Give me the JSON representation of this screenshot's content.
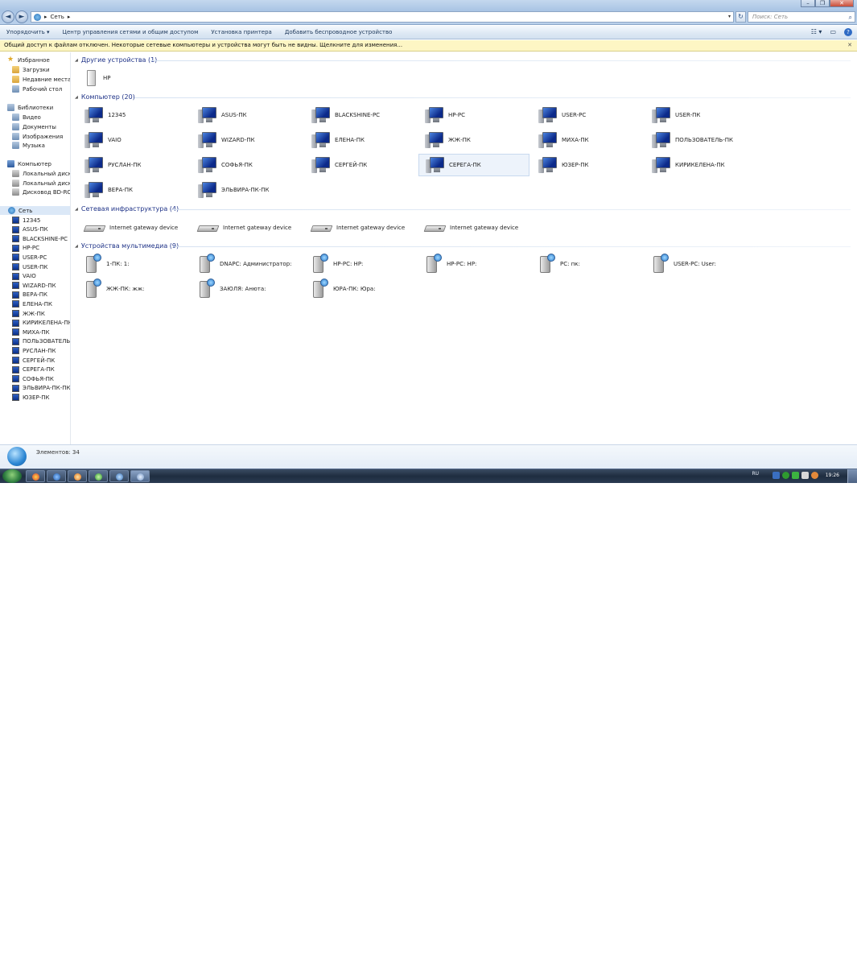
{
  "window": {
    "minimize_glyph": "–",
    "restore_glyph": "❐",
    "close_glyph": "✕"
  },
  "address": {
    "breadcrumb_sep": "▸",
    "location": "Сеть",
    "trail_sep": "▸",
    "dropdown_glyph": "▾",
    "refresh_glyph": "↻",
    "search_placeholder": "Поиск: Сеть",
    "search_glyph": "⌕"
  },
  "toolbar": {
    "organize": "Упорядочить ▾",
    "network_center": "Центр управления сетями и общим доступом",
    "add_printer": "Установка принтера",
    "add_wireless": "Добавить беспроводное устройство",
    "views_glyph": "☷ ▾",
    "preview_glyph": "▭",
    "help_glyph": "?"
  },
  "infobar": {
    "text": "Общий доступ к файлам отключен. Некоторые сетевые компьютеры и устройства могут быть не видны. Щелкните для изменения...",
    "close_glyph": "✕"
  },
  "nav": {
    "favorites": "Избранное",
    "downloads": "Загрузки",
    "recent": "Недавние места",
    "desktop": "Рабочий стол",
    "libraries": "Библиотеки",
    "video": "Видео",
    "documents": "Документы",
    "images": "Изображения",
    "music": "Музыка",
    "computer": "Компьютер",
    "local_c": "Локальный диск (C:",
    "local_d": "Локальный диск (D:",
    "bdrom": "Дисковод BD-ROM",
    "network": "Сеть",
    "network_items": [
      "12345",
      "ASUS-ПК",
      "BLACKSHINE-PC",
      "HP-PC",
      "USER-PC",
      "USER-ПК",
      "VAIO",
      "WIZARD-ПК",
      "ВЕРА-ПК",
      "ЕЛЕНА-ПК",
      "ЖЖ-ПК",
      "КИРИКЕЛЕНА-ПК",
      "МИХА-ПК",
      "ПОЛЬЗОВАТЕЛЬ-П",
      "РУСЛАН-ПК",
      "СЕРГЕЙ-ПК",
      "СЕРЕГА-ПК",
      "СОФЬЯ-ПК",
      "ЭЛЬВИРА-ПК-ПК",
      "ЮЗЕР-ПК"
    ]
  },
  "groups": {
    "collapse_glyph": "◢",
    "other": {
      "title": "Другие устройства (1)",
      "items": [
        "HP"
      ]
    },
    "computers": {
      "title": "Компьютер (20)",
      "items": [
        "12345",
        "ASUS-ПК",
        "BLACKSHINE-PC",
        "HP-PC",
        "USER-PC",
        "USER-ПК",
        "VAIO",
        "WIZARD-ПК",
        "ЕЛЕНА-ПК",
        "ЖЖ-ПК",
        "МИХА-ПК",
        "ПОЛЬЗОВАТЕЛЬ-ПК",
        "РУСЛАН-ПК",
        "СОФЬЯ-ПК",
        "СЕРГЕЙ-ПК",
        "СЕРЕГА-ПК",
        "ЮЗЕР-ПК",
        "КИРИКЕЛЕНА-ПК",
        "ВЕРА-ПК",
        "ЭЛЬВИРА-ПК-ПК"
      ]
    },
    "infra": {
      "title": "Сетевая инфраструктура (4)",
      "items": [
        "Internet gateway device",
        "Internet gateway device",
        "Internet gateway device",
        "Internet gateway device"
      ]
    },
    "media": {
      "title": "Устройства мультимедиа (9)",
      "items": [
        "1-ПК: 1:",
        "DNAPC: Администратор:",
        "HP-PC: HP:",
        "HP-PC: HP:",
        "PC: пк:",
        "USER-PC: User:",
        "ЖЖ-ПК: жж:",
        "ЗАЮЛЯ: Анюта:",
        "ЮРА-ПК: Юра:"
      ]
    }
  },
  "status": {
    "count": "Элементов: 34"
  },
  "taskbar": {
    "lang": "RU",
    "clock": "19:26"
  }
}
